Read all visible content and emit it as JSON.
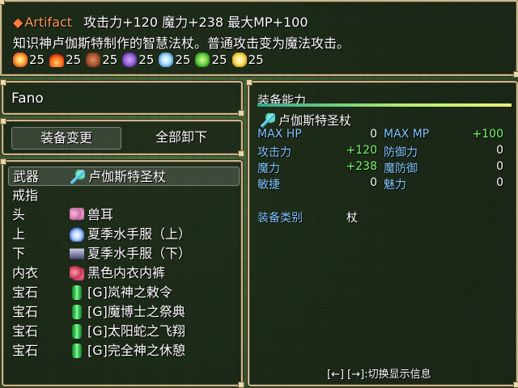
{
  "help": {
    "item_marker": "◆",
    "item_name": "Artifact",
    "bonuses": "攻击力+120 魔力+238 最大MP+100",
    "description": "知识神卢伽斯特制作的智慧法杖。普通攻击变为魔法攻击。",
    "resistances": [
      {
        "icon": "fire-star-icon",
        "value": "25"
      },
      {
        "icon": "flame-icon",
        "value": "25"
      },
      {
        "icon": "rock-icon",
        "value": "25"
      },
      {
        "icon": "wind-icon",
        "value": "25"
      },
      {
        "icon": "ice-icon",
        "value": "25"
      },
      {
        "icon": "leaf-icon",
        "value": "25"
      },
      {
        "icon": "lightning-icon",
        "value": "25"
      }
    ]
  },
  "actor": {
    "name": "Fano"
  },
  "commands": {
    "equip": "装备变更",
    "clear": "全部卸下"
  },
  "slots": [
    {
      "label": "武器",
      "item": "卢伽斯特圣杖",
      "icon": "staff-icon"
    },
    {
      "label": "戒指",
      "item": "",
      "icon": ""
    },
    {
      "label": "头",
      "item": "兽耳",
      "icon": "animal-ears-icon"
    },
    {
      "label": "上",
      "item": "夏季水手服（上）",
      "icon": "sailor-top-icon"
    },
    {
      "label": "下",
      "item": "夏季水手服（下）",
      "icon": "sailor-skirt-icon"
    },
    {
      "label": "内衣",
      "item": "黑色内衣内裤",
      "icon": "underwear-icon"
    },
    {
      "label": "宝石",
      "item": "[G]岚神之敕令",
      "icon": "gem-icon"
    },
    {
      "label": "宝石",
      "item": "[G]魔博士之祭典",
      "icon": "gem-icon"
    },
    {
      "label": "宝石",
      "item": "[G]太阳蛇之飞翔",
      "icon": "gem-icon"
    },
    {
      "label": "宝石",
      "item": "[G]完全神之休憩",
      "icon": "gem-icon"
    }
  ],
  "status": {
    "title": "装备能力",
    "item": "卢伽斯特圣杖",
    "params": [
      {
        "name": "MAX HP",
        "value": "0"
      },
      {
        "name": "MAX MP",
        "value": "+100"
      },
      {
        "name": "攻击力",
        "value": "+120"
      },
      {
        "name": "防御力",
        "value": "0"
      },
      {
        "name": "魔力",
        "value": "+238"
      },
      {
        "name": "魔防御",
        "value": "0"
      },
      {
        "name": "敏捷",
        "value": "0"
      },
      {
        "name": "魅力",
        "value": "0"
      }
    ],
    "category_label": "装备类别",
    "category_value": "杖",
    "hint": "[←] [→]:切换显示信息"
  },
  "colors": {
    "item_name": "#ff9a5a",
    "param_label": "#84c8ff",
    "param_increase": "#7cff6a",
    "window_border": "#c8b98a"
  }
}
